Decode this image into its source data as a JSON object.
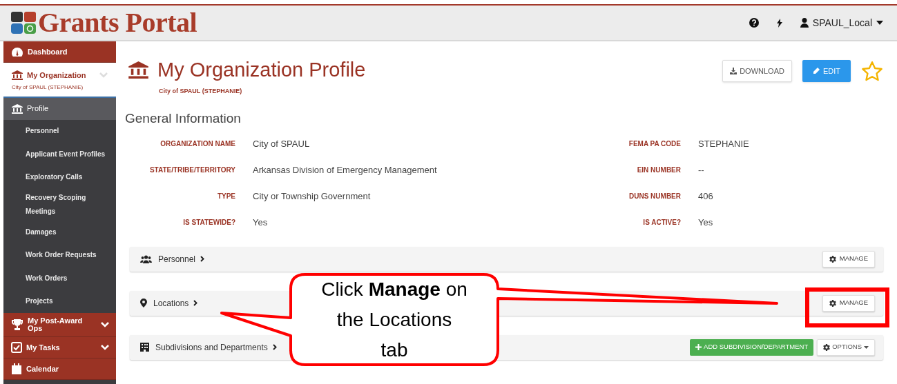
{
  "header": {
    "logo_text": "Grants Portal",
    "user": "SPAUL_Local"
  },
  "sidebar": {
    "items": [
      {
        "kind": "nav",
        "label": "Dashboard",
        "selected": false
      },
      {
        "kind": "org",
        "label": "My Organization",
        "sublabel": "City of SPAUL (STEPHANIE)",
        "selected": false
      },
      {
        "kind": "page",
        "label": "Profile",
        "selected": true
      },
      {
        "kind": "sub",
        "label": "Personnel",
        "selected": false
      },
      {
        "kind": "sub",
        "label": "Applicant Event Profiles",
        "selected": false
      },
      {
        "kind": "sub",
        "label": "Exploratory Calls",
        "selected": false
      },
      {
        "kind": "sub",
        "label": "Recovery Scoping Meetings",
        "selected": false
      },
      {
        "kind": "sub",
        "label": "Damages",
        "selected": false
      },
      {
        "kind": "sub",
        "label": "Work Order Requests",
        "selected": false
      },
      {
        "kind": "sub",
        "label": "Work Orders",
        "selected": false
      },
      {
        "kind": "sub",
        "label": "Projects",
        "selected": false
      },
      {
        "kind": "group",
        "label": "My Post-Award Ops",
        "selected": false
      },
      {
        "kind": "group",
        "label": "My Tasks",
        "selected": false
      },
      {
        "kind": "nav",
        "label": "Calendar",
        "selected": false
      }
    ]
  },
  "page": {
    "title": "My Organization Profile",
    "subtitle": "City of SPAUL (STEPHANIE)",
    "buttons": [
      {
        "kind": "download",
        "label": "DOWNLOAD"
      },
      {
        "kind": "edit",
        "label": "EDIT"
      }
    ],
    "favorite": false
  },
  "general_information": {
    "title": "General Information",
    "rows": [
      {
        "label": "ORGANIZATION NAME",
        "value": "City of SPAUL",
        "label_2": "FEMA PA CODE",
        "value_2": "STEPHANIE"
      },
      {
        "label": "STATE/TRIBE/TERRITORY",
        "value": "Arkansas Division of Emergency Management",
        "label_2": "EIN NUMBER",
        "value_2": "--"
      },
      {
        "label": "TYPE",
        "value": "City or Township Government",
        "label_2": "DUNS NUMBER",
        "value_2": "406"
      },
      {
        "label": "IS STATEWIDE?",
        "value": "Yes",
        "label_2": "IS ACTIVE?",
        "value_2": "Yes"
      }
    ]
  },
  "panels": [
    {
      "kind": "personnel",
      "label": "Personnel",
      "actions": [
        {
          "kind": "manage",
          "label": "MANAGE"
        }
      ]
    },
    {
      "kind": "locations",
      "label": "Locations",
      "actions": [
        {
          "kind": "manage",
          "label": "MANAGE"
        }
      ]
    },
    {
      "kind": "subdivisions",
      "label": "Subdivisions and Departments",
      "actions": [
        {
          "kind": "add",
          "label": "ADD SUBDIVISION/DEPARTMENT"
        },
        {
          "kind": "options",
          "label": "OPTIONS"
        }
      ]
    }
  ],
  "annotation": {
    "text": "Click **Manage** on the Locations tab"
  }
}
